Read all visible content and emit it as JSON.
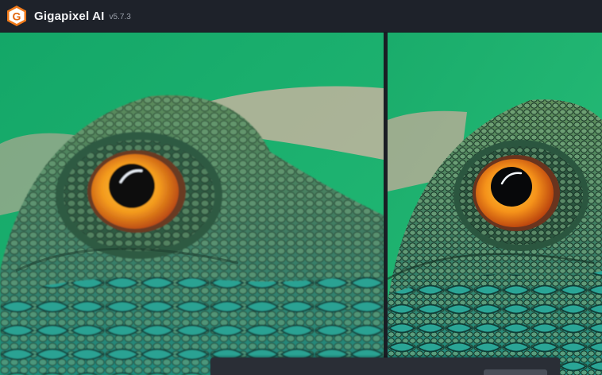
{
  "window": {
    "app_name": "Gigapixel AI",
    "version": "v5.7.3",
    "logo_letter": "G",
    "logo_icon": "gigapixel-logo-icon"
  },
  "preview": {
    "left_pane": "original-preview",
    "right_pane": "enhanced-preview",
    "subject": "iguana-eye-closeup"
  },
  "colors": {
    "accent": "#f07a1a",
    "titlebar": "#1e222a",
    "background_green": "#1fae6a"
  }
}
